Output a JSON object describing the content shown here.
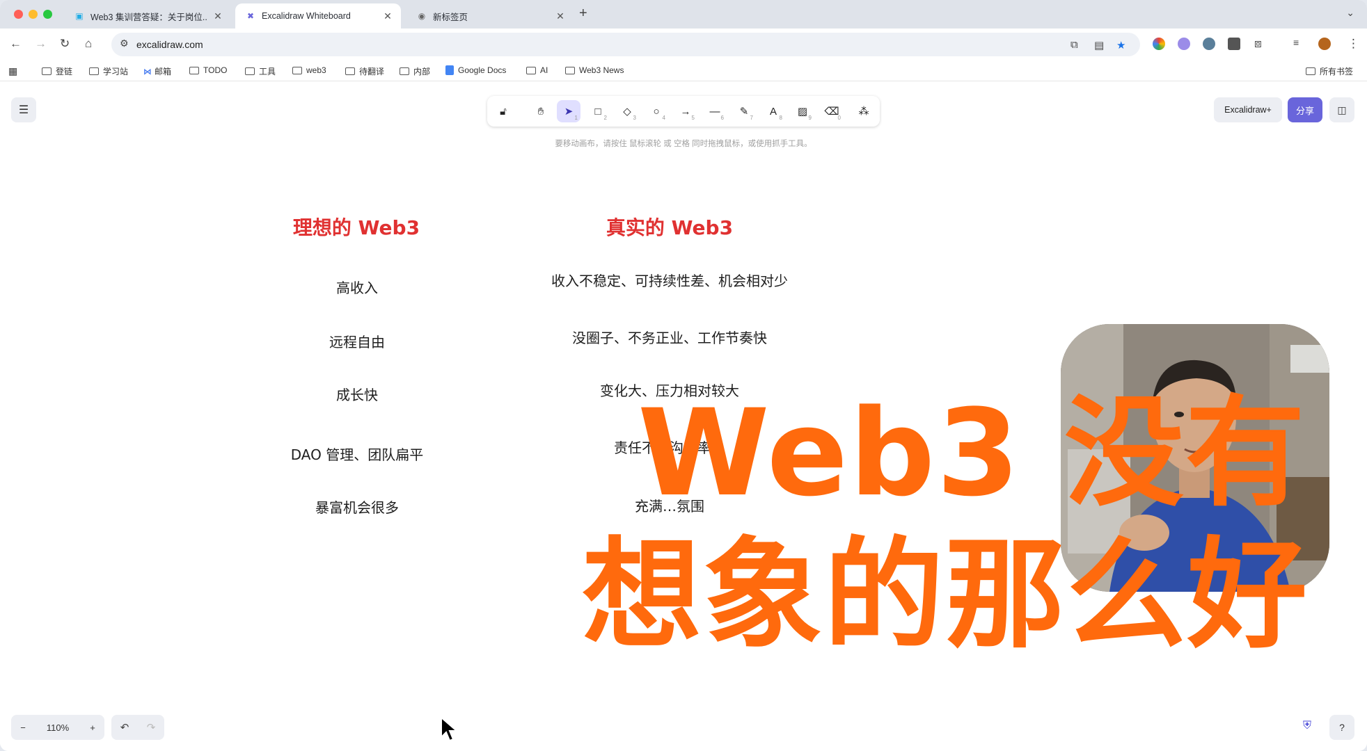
{
  "browser": {
    "tabs": [
      {
        "title": "Web3 集训营答疑：关于岗位..",
        "icon": "bilibili-icon"
      },
      {
        "title": "Excalidraw Whiteboard",
        "icon": "excalidraw-icon",
        "active": true
      },
      {
        "title": "新标签页",
        "icon": "chrome-icon"
      }
    ],
    "url": "excalidraw.com",
    "bookmarks": [
      "登链",
      "学习站",
      "邮箱",
      "TODO",
      "工具",
      "web3",
      "待翻译",
      "内部",
      "Google Docs",
      "AI",
      "Web3 News"
    ],
    "all_bookmarks": "所有书签"
  },
  "excalidraw": {
    "hint": "要移动画布，请按住 鼠标滚轮 或 空格 同时拖拽鼠标，或使用抓手工具。",
    "plus_label": "Excalidraw+",
    "share_label": "分享",
    "zoom": "110%",
    "tools": [
      {
        "icon": "lock-icon",
        "key": ""
      },
      {
        "icon": "hand-icon",
        "key": ""
      },
      {
        "icon": "pointer-icon",
        "key": "1"
      },
      {
        "icon": "rectangle-icon",
        "key": "2"
      },
      {
        "icon": "diamond-icon",
        "key": "3"
      },
      {
        "icon": "ellipse-icon",
        "key": "4"
      },
      {
        "icon": "arrow-icon",
        "key": "5"
      },
      {
        "icon": "line-icon",
        "key": "6"
      },
      {
        "icon": "pencil-icon",
        "key": "7"
      },
      {
        "icon": "text-icon",
        "key": "8"
      },
      {
        "icon": "image-icon",
        "key": "9"
      },
      {
        "icon": "eraser-icon",
        "key": "0"
      },
      {
        "icon": "more-tools-icon",
        "key": ""
      }
    ]
  },
  "board": {
    "left_heading": "理想的 Web3",
    "right_heading": "真实的 Web3",
    "left_items": [
      "高收入",
      "远程自由",
      "成长快",
      "DAO 管理、团队扁平",
      "暴富机会很多"
    ],
    "right_items": [
      "收入不稳定、可持续性差、机会相对少",
      "没圈子、不务正业、工作节奏快",
      "变化大、压力相对较大",
      "责任不…沟…率…",
      "充满…氛围"
    ]
  },
  "overlay": {
    "line1": "Web3 没有",
    "line2": "想象的那么好",
    "color": "#ff6a0d"
  }
}
